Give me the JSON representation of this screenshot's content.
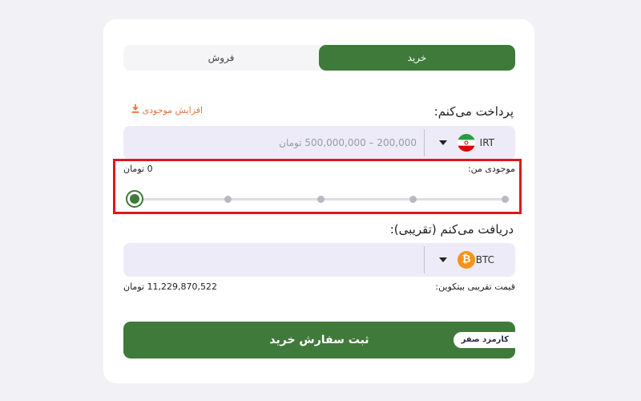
{
  "tabs": {
    "buy": "خرید",
    "sell": "فروش"
  },
  "pay": {
    "label": "پرداخت می‌کنم:",
    "increase_balance": "افزایش موجودی",
    "currency": "IRT",
    "placeholder": "200,000 – 500,000,000 تومان"
  },
  "wallet": {
    "label": "موجودی من:",
    "value": "0 تومان",
    "slider_level": 0,
    "slider_steps": 5
  },
  "receive": {
    "label": "دریافت می‌کنم (تقریبی):",
    "currency": "BTC"
  },
  "price": {
    "label": "قیمت تقریبی بیتکوین:",
    "value": "11,229,870,522 تومان"
  },
  "submit": {
    "label": "ثبت سفارش خرید",
    "badge": "کارمزد صفر"
  },
  "colors": {
    "accent": "#3f7a3a",
    "orange": "#e8763b",
    "highlight": "#e0161d",
    "btc": "#f7931a"
  }
}
